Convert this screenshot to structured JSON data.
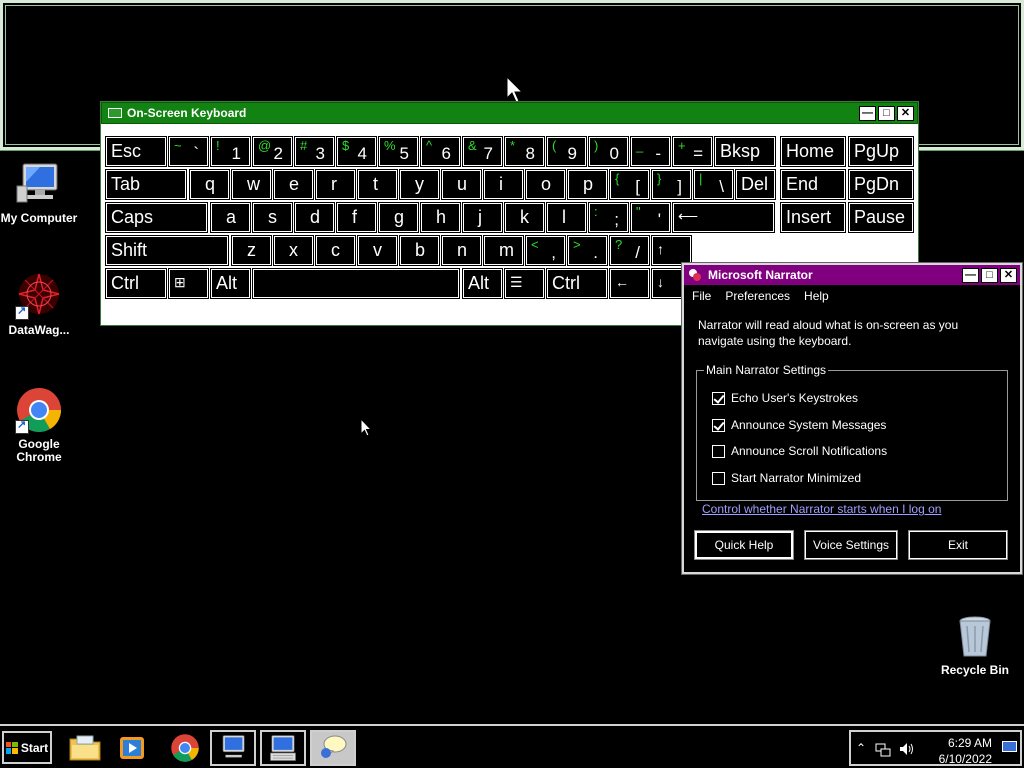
{
  "desktop": {
    "icons": [
      {
        "label": "My Computer",
        "icon": "computer-icon"
      },
      {
        "label": "DataWag...",
        "icon": "datawag-icon"
      },
      {
        "label": "Google Chrome",
        "icon": "chrome-icon"
      },
      {
        "label": "Recycle Bin",
        "icon": "recycle-bin-icon"
      }
    ]
  },
  "osk": {
    "title": "On-Screen Keyboard",
    "rows": [
      [
        {
          "label": "Esc"
        },
        {
          "shift": "~",
          "main": "`"
        },
        {
          "shift": "!",
          "main": "1"
        },
        {
          "shift": "@",
          "main": "2"
        },
        {
          "shift": "#",
          "main": "3"
        },
        {
          "shift": "$",
          "main": "4"
        },
        {
          "shift": "%",
          "main": "5"
        },
        {
          "shift": "^",
          "main": "6"
        },
        {
          "shift": "&",
          "main": "7"
        },
        {
          "shift": "*",
          "main": "8"
        },
        {
          "shift": "(",
          "main": "9"
        },
        {
          "shift": ")",
          "main": "0"
        },
        {
          "shift": "_",
          "main": "-"
        },
        {
          "shift": "+",
          "main": "="
        },
        {
          "label": "Bksp"
        },
        {
          "label": "Home"
        },
        {
          "label": "PgUp"
        }
      ],
      [
        {
          "label": "Tab"
        },
        {
          "single": "q"
        },
        {
          "single": "w"
        },
        {
          "single": "e"
        },
        {
          "single": "r"
        },
        {
          "single": "t"
        },
        {
          "single": "y"
        },
        {
          "single": "u"
        },
        {
          "single": "i"
        },
        {
          "single": "o"
        },
        {
          "single": "p"
        },
        {
          "shift": "{",
          "main": "["
        },
        {
          "shift": "}",
          "main": "]"
        },
        {
          "shift": "|",
          "main": "\\"
        },
        {
          "label": "Del"
        },
        {
          "label": "End"
        },
        {
          "label": "PgDn"
        }
      ],
      [
        {
          "label": "Caps"
        },
        {
          "single": "a"
        },
        {
          "single": "s"
        },
        {
          "single": "d"
        },
        {
          "single": "f"
        },
        {
          "single": "g"
        },
        {
          "single": "h"
        },
        {
          "single": "j"
        },
        {
          "single": "k"
        },
        {
          "single": "l"
        },
        {
          "shift": ":",
          "main": ";"
        },
        {
          "shift": "\"",
          "main": "'"
        },
        {
          "label": "⟵"
        },
        {
          "label": "Insert"
        },
        {
          "label": "Pause"
        }
      ],
      [
        {
          "label": "Shift"
        },
        {
          "single": "z"
        },
        {
          "single": "x"
        },
        {
          "single": "c"
        },
        {
          "single": "v"
        },
        {
          "single": "b"
        },
        {
          "single": "n"
        },
        {
          "single": "m"
        },
        {
          "shift": "<",
          "main": ","
        },
        {
          "shift": ">",
          "main": "."
        },
        {
          "shift": "?",
          "main": "/"
        },
        {
          "label": "↑"
        }
      ],
      [
        {
          "label": "Ctrl"
        },
        {
          "label": "⊞"
        },
        {
          "label": "Alt"
        },
        {
          "label": ""
        },
        {
          "label": "Alt"
        },
        {
          "label": "☰"
        },
        {
          "label": "Ctrl"
        },
        {
          "label": "←"
        },
        {
          "label": "↓"
        }
      ]
    ]
  },
  "narrator": {
    "title": "Microsoft Narrator",
    "menu": [
      "File",
      "Preferences",
      "Help"
    ],
    "description": "Narrator will read aloud what is on-screen as you navigate using the keyboard.",
    "group_label": "Main Narrator Settings",
    "options": [
      {
        "label": "Echo User's Keystrokes",
        "checked": true
      },
      {
        "label": "Announce System Messages",
        "checked": true
      },
      {
        "label": "Announce Scroll Notifications",
        "checked": false
      },
      {
        "label": "Start Narrator Minimized",
        "checked": false
      }
    ],
    "link": "Control whether Narrator starts when I log on",
    "buttons": {
      "quick_help": "Quick Help",
      "voice_settings": "Voice Settings",
      "exit": "Exit"
    }
  },
  "taskbar": {
    "start_label": "Start",
    "clock": {
      "time": "6:29 AM",
      "date": "6/10/2022"
    }
  },
  "colors": {
    "osk_title": "#128212",
    "narrator_title": "#800080",
    "shift_glyph": "#2edc2e",
    "link": "#9f9fff"
  }
}
